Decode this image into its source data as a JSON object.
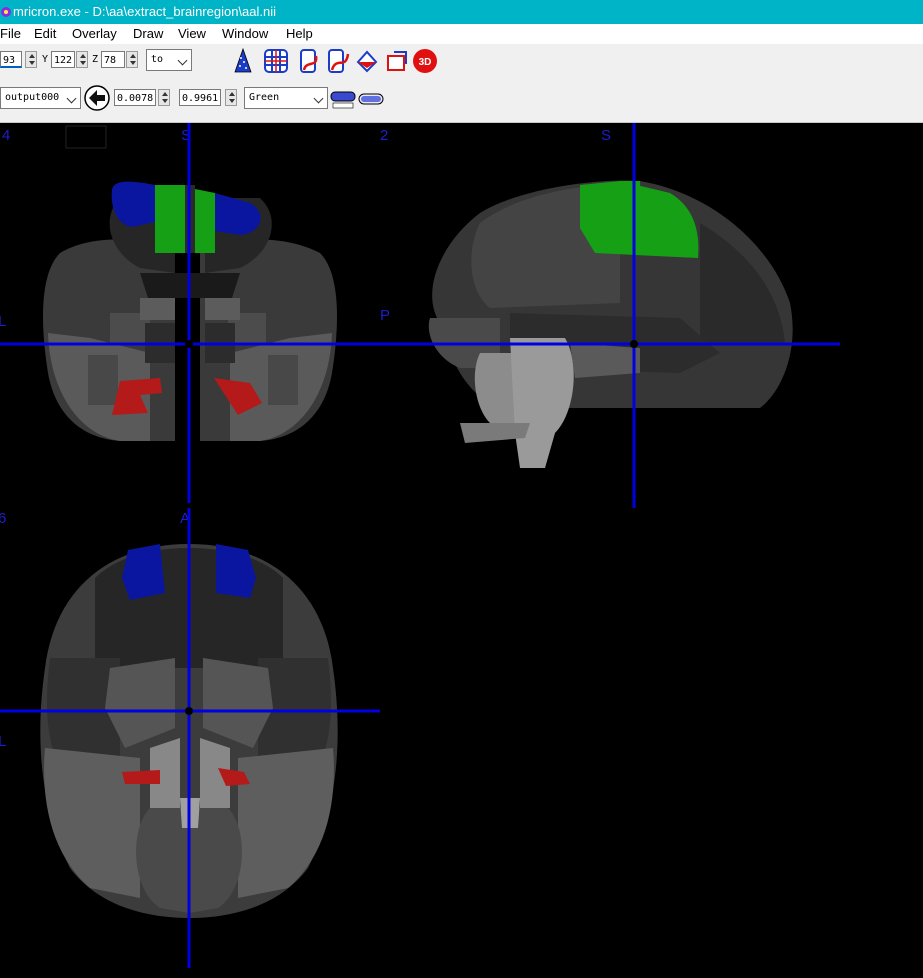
{
  "window": {
    "title": "mricron.exe - D:\\aa\\extract_brainregion\\aal.nii"
  },
  "menu": [
    "File",
    "Edit",
    "Overlay",
    "Draw",
    "View",
    "Window",
    "Help"
  ],
  "toolbar": {
    "x_value": "93",
    "y_label": "Y",
    "y_value": "122",
    "z_label": "Z",
    "z_value": "78",
    "to_label": "to",
    "overlay_select": "output000",
    "min_value": "0.0078",
    "max_value": "0.9961",
    "colormap": "Green"
  },
  "views": {
    "coronal": {
      "top_left": "4",
      "top_marker": "S",
      "left_marker": "L"
    },
    "sagittal": {
      "top_left": "2",
      "top_marker": "S",
      "left_marker": "P"
    },
    "axial": {
      "top_left": "6",
      "top_marker": "A",
      "left_marker": "L"
    }
  },
  "colors": {
    "titlebar": "#00b4c8",
    "crosshair": "#0000e0",
    "overlay_green": "#16a016",
    "overlay_blue": "#0a16a0",
    "overlay_red": "#b41a1a"
  }
}
